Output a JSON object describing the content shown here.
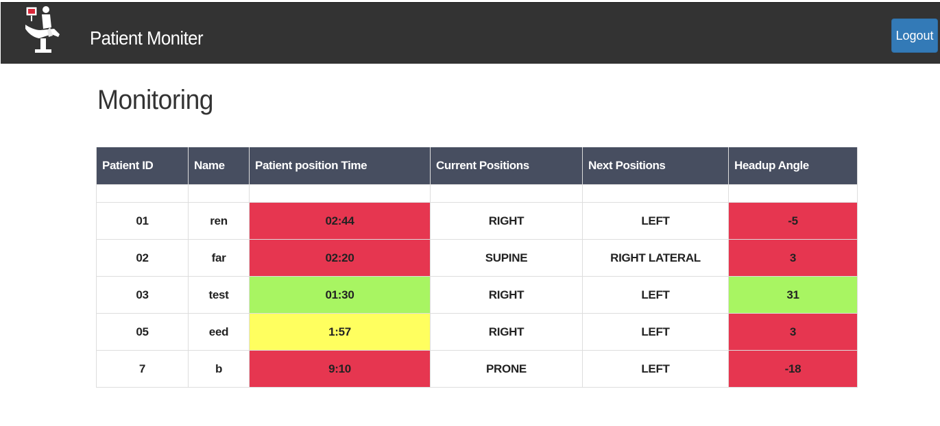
{
  "header": {
    "brand": "Patient Moniter",
    "logout_label": "Logout"
  },
  "page": {
    "title": "Monitoring"
  },
  "colors": {
    "navbar": "#333333",
    "table_header": "#474e60",
    "logout_button": "#337ab7",
    "status_red": "#e63650",
    "status_green": "#a8f562",
    "status_yellow": "#ffff5f"
  },
  "table": {
    "columns": [
      "Patient ID",
      "Name",
      "Patient position Time",
      "Current Positions",
      "Next Positions",
      "Headup Angle"
    ],
    "rows": [
      {
        "id": "01",
        "name": "ren",
        "time": "02:44",
        "time_status": "red",
        "current": "RIGHT",
        "next": "LEFT",
        "angle": "-5",
        "angle_status": "red"
      },
      {
        "id": "02",
        "name": "far",
        "time": "02:20",
        "time_status": "red",
        "current": "SUPINE",
        "next": "RIGHT LATERAL",
        "angle": "3",
        "angle_status": "red"
      },
      {
        "id": "03",
        "name": "test",
        "time": "01:30",
        "time_status": "green",
        "current": "RIGHT",
        "next": "LEFT",
        "angle": "31",
        "angle_status": "green"
      },
      {
        "id": "05",
        "name": "eed",
        "time": "1:57",
        "time_status": "yellow",
        "current": "RIGHT",
        "next": "LEFT",
        "angle": "3",
        "angle_status": "red"
      },
      {
        "id": "7",
        "name": "b",
        "time": "9:10",
        "time_status": "red",
        "current": "PRONE",
        "next": "LEFT",
        "angle": "-18",
        "angle_status": "red"
      }
    ]
  }
}
